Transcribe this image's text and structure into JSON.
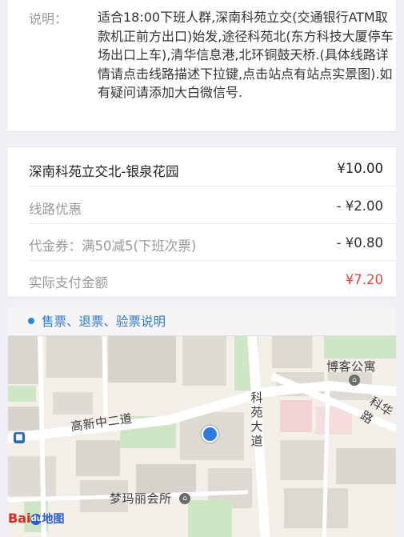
{
  "description": {
    "label": "说明：",
    "text": "适合18:00下班人群,深南科苑立交(交通银行ATM取款机正前方出口)始发,途径科苑北(东方科技大厦停车场出口上车),清华信息港,北环铜鼓天桥.(具体线路详情请点击线路描述下拉键,点击站点有站点实景图).如有疑问请添加大白微信号."
  },
  "pricing": {
    "route_name": "深南科苑立交北-银泉花园",
    "route_price": "¥10.00",
    "discount_label": "线路优惠",
    "discount_value": "- ¥2.00",
    "voucher_label": "代金券：满50减5(下班次票)",
    "voucher_value": "- ¥0.80",
    "actual_label": "实际支付金额",
    "actual_value": "¥7.20"
  },
  "notice": {
    "link_text": "售票、退票、验票说明"
  },
  "map": {
    "labels": {
      "boke": "博客公寓",
      "road_gaoxin": "高新中二道",
      "road_keyuan": "科苑大道",
      "road_kehua": "科华路",
      "mengma": "梦玛丽会所"
    },
    "logo_bai": "Bai",
    "logo_du": "du",
    "logo_map": "地图"
  },
  "colors": {
    "accent_blue": "#2d79c8",
    "price_red": "#e8453c",
    "muted_gray": "#9a9a9a"
  }
}
